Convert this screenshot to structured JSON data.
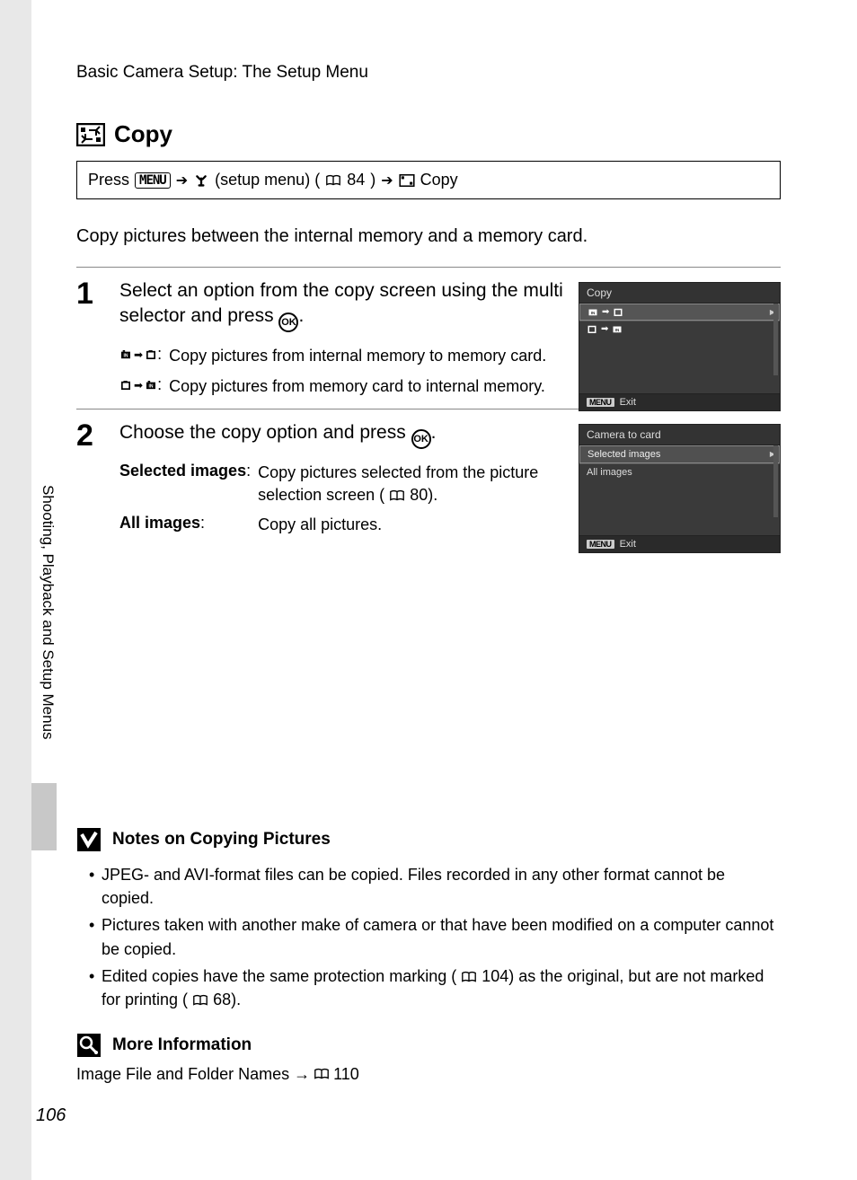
{
  "header": "Basic Camera Setup: The Setup Menu",
  "title": "Copy",
  "path": {
    "press": "Press",
    "menu_btn": "MENU",
    "setup_label": "(setup menu) (",
    "page_ref_setup": "84",
    "close_paren": ")",
    "copy_label": "Copy"
  },
  "intro": "Copy pictures between the internal memory and a memory card.",
  "step1": {
    "num": "1",
    "lead": "Select an option from the copy screen using the multi selector and press",
    "opt1_desc": "Copy pictures from internal memory to memory card.",
    "opt2_desc": "Copy pictures from memory card to internal memory.",
    "lcd_title": "Copy",
    "lcd_exit": "Exit",
    "lcd_menu": "MENU"
  },
  "step2": {
    "num": "2",
    "lead": "Choose the copy option and press",
    "row1_k": "Selected images",
    "row1_v_a": "Copy pictures selected from the picture selection screen (",
    "row1_v_page": "80",
    "row1_v_b": ").",
    "row2_k": "All images",
    "row2_v": "Copy all pictures.",
    "lcd_title": "Camera to card",
    "lcd_r1": "Selected images",
    "lcd_r2": "All images",
    "lcd_exit": "Exit",
    "lcd_menu": "MENU"
  },
  "notes": {
    "title": "Notes on Copying Pictures",
    "li1": "JPEG- and AVI-format files can be copied. Files recorded in any other format cannot be copied.",
    "li2": "Pictures taken with another make of camera or that have been modified on a computer cannot be copied.",
    "li3a": "Edited copies have the same protection marking (",
    "li3_p1": "104",
    "li3b": ") as the original, but are not marked for printing (",
    "li3_p2": "68",
    "li3c": ")."
  },
  "more": {
    "title": "More Information",
    "line_a": "Image File and Folder Names →",
    "line_page": "110"
  },
  "side_label": "Shooting, Playback and Setup Menus",
  "page_num": "106"
}
